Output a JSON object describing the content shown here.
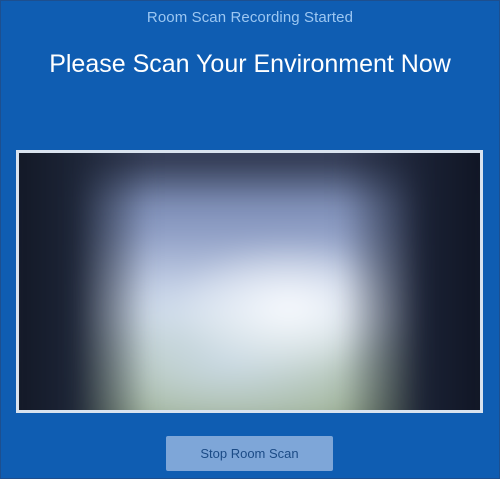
{
  "status": {
    "text": "Room Scan Recording Started"
  },
  "heading": {
    "text": "Please Scan Your Environment Now"
  },
  "button": {
    "label": "Stop Room Scan"
  },
  "colors": {
    "background": "#0f5db2",
    "status_text": "#9cc7f2",
    "heading_text": "#ffffff",
    "button_bg": "#7ea6d8",
    "button_text": "#1b4b86",
    "frame_border": "#d9e3ef"
  }
}
